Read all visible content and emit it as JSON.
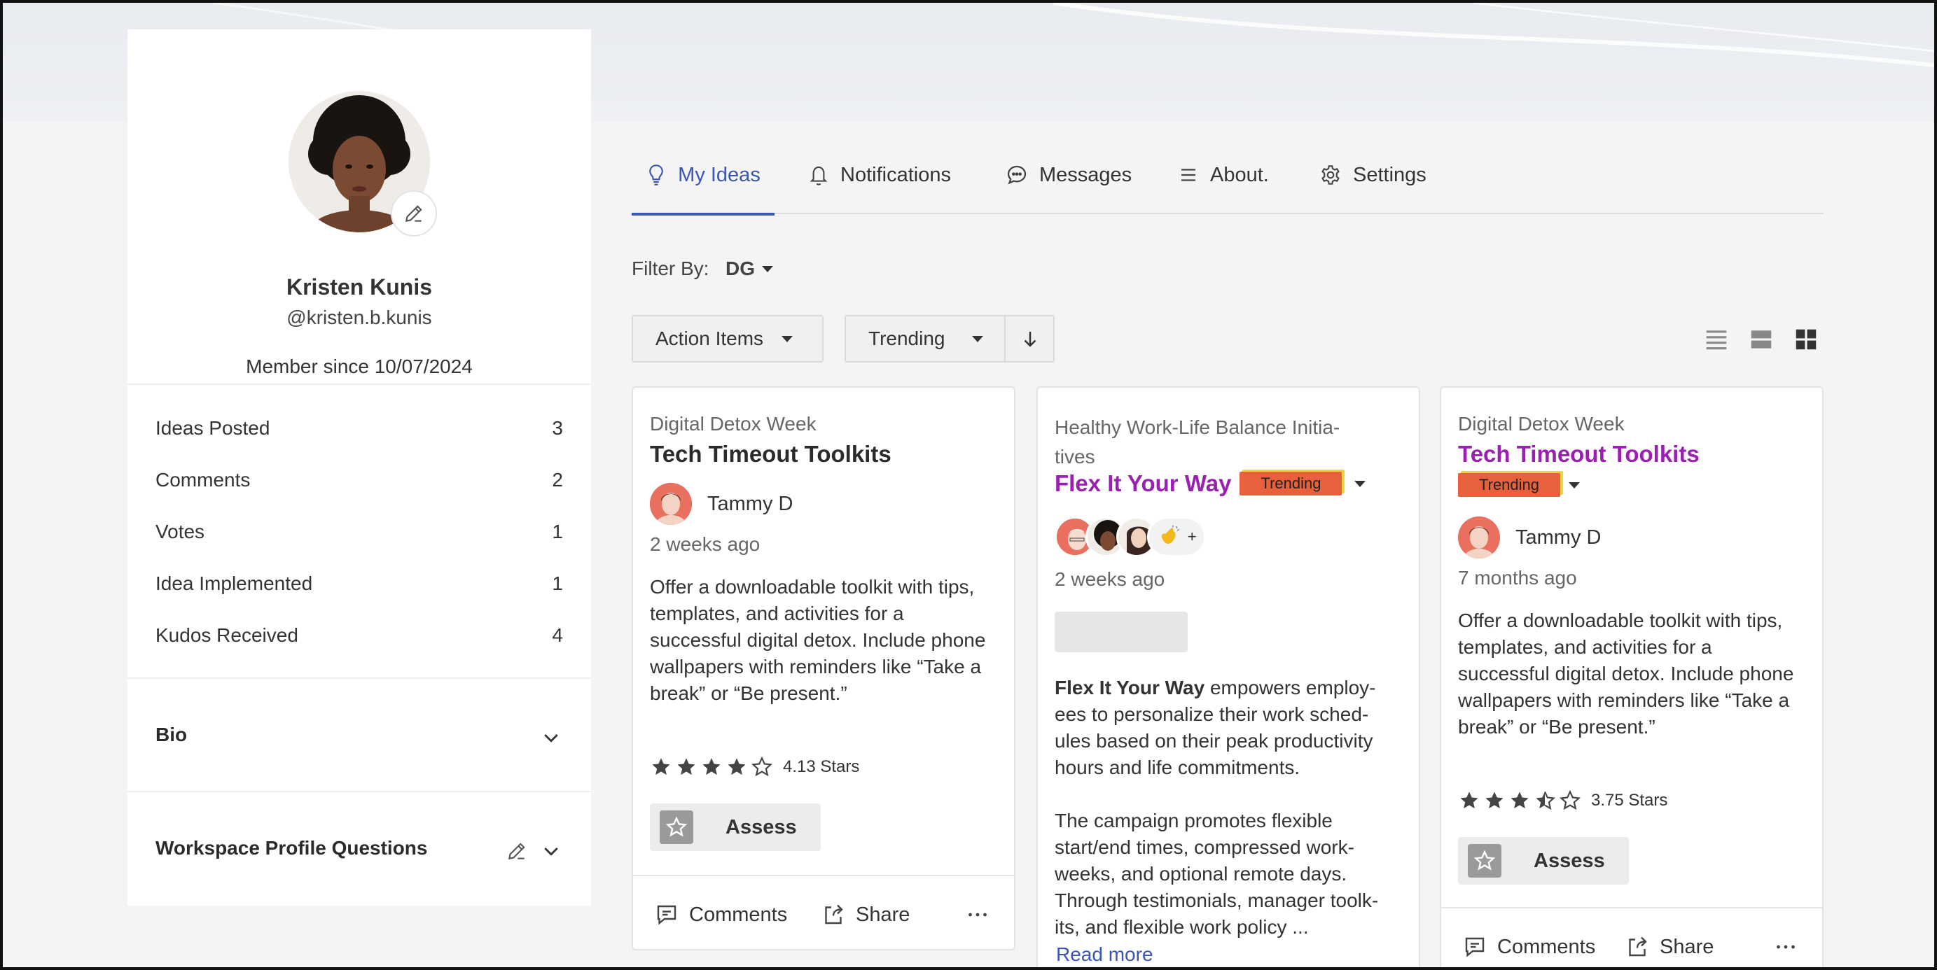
{
  "profile": {
    "name": "Kristen Kunis",
    "handle": "@kristen.b.kunis",
    "member_since": "Member since 10/07/2024"
  },
  "stats": [
    {
      "label": "Ideas Posted",
      "value": "3"
    },
    {
      "label": "Comments",
      "value": "2"
    },
    {
      "label": "Votes",
      "value": "1"
    },
    {
      "label": "Idea Implemented",
      "value": "1"
    },
    {
      "label": "Kudos Received",
      "value": "4"
    }
  ],
  "sections": {
    "bio": "Bio",
    "workspace": "Workspace Profile Questions"
  },
  "tabs": [
    {
      "label": "My Ideas",
      "icon": "lightbulb-icon"
    },
    {
      "label": "Notifications",
      "icon": "bell-icon"
    },
    {
      "label": "Messages",
      "icon": "chat-bubble-icon"
    },
    {
      "label": "About.",
      "icon": "hamburger-icon"
    },
    {
      "label": "Settings",
      "icon": "gear-icon"
    }
  ],
  "filter": {
    "label": "Filter By:",
    "value": "DG"
  },
  "toolbar": {
    "action_items": "Action Items",
    "sort": "Trending"
  },
  "cards": [
    {
      "category": "Digital Detox Week",
      "title": "Tech Timeout Toolkits",
      "author": "Tammy D",
      "time": "2 weeks ago",
      "description": "Offer a downloadable toolkit with tips, templates, and activities for a successful digital detox. Include phone wallpapers with reminders like “Take a break” or “Be present.”",
      "rating_text": "4.13 Stars",
      "rating": 4.13,
      "assess": "Assess",
      "comments": "Comments",
      "share": "Share"
    },
    {
      "category_line1": "Healthy Work-Life Balance Initia-",
      "category_line2": "tives",
      "title": "Flex It Your Way",
      "badge": "Trending",
      "time": "2 weeks ago",
      "desc_bold": "Flex It Your Way",
      "desc_p1_rest": " empowers employ-",
      "desc_p1_l2": "ees to personalize their work sched-",
      "desc_p1_l3": "ules based on their peak productivity",
      "desc_p1_l4": "hours and life commitments.",
      "desc_p2_l1": "The campaign promotes flexible",
      "desc_p2_l2": "start/end times, compressed work-",
      "desc_p2_l3": "weeks, and optional remote days.",
      "desc_p2_l4": "Through testimonials, manager toolk-",
      "desc_p2_l5": "its, and flexible work policy ...",
      "read_more": "Read more",
      "avatars_plus": "+"
    },
    {
      "category": "Digital Detox Week",
      "title": "Tech Timeout Toolkits",
      "badge": "Trending",
      "author": "Tammy D",
      "time": "7 months ago",
      "description": "Offer a downloadable toolkit with tips, templates, and activities for a successful digital detox. Include phone wallpapers with reminders like “Take a break” or “Be present.”",
      "rating_text": "3.75 Stars",
      "rating": 3.75,
      "assess": "Assess",
      "comments": "Comments",
      "share": "Share"
    }
  ],
  "colors": {
    "accent": "#3a55b4",
    "title_purple": "#9b1fb1",
    "trending": "#e8603c"
  }
}
